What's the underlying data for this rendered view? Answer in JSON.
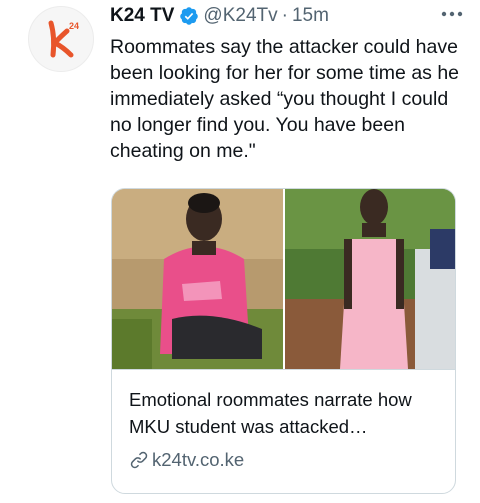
{
  "tweet": {
    "author_name": "K24 TV",
    "handle": "@K24Tv",
    "separator": "·",
    "timestamp": "15m",
    "text": "Roommates say the attacker could have been looking for her for some time as he immediately asked “you thought I could no longer find you. You have been cheating on me.\"",
    "avatar_logo_text": "k",
    "avatar_logo_superscript": "24"
  },
  "link_card": {
    "title": "Emotional roommates narrate how MKU student was attacked…",
    "domain": "k24tv.co.ke",
    "icon": "link-icon"
  },
  "icons": {
    "verified": "verified-badge-icon",
    "more": "more-options-icon"
  },
  "colors": {
    "brand_orange": "#e8552b",
    "verified_blue": "#1d9bf0",
    "secondary_text": "#536471"
  }
}
